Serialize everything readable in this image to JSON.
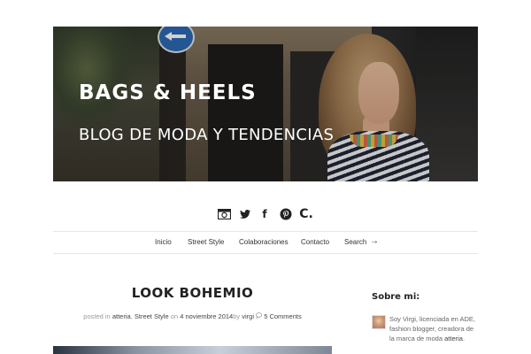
{
  "header": {
    "title": "BAGS & HEELS",
    "subtitle": "BLOG DE MODA Y TENDENCIAS"
  },
  "social": [
    {
      "icon": "camera-icon"
    },
    {
      "icon": "twitter-icon"
    },
    {
      "icon": "facebook-icon",
      "glyph": "f"
    },
    {
      "icon": "pinterest-icon"
    },
    {
      "icon": "chicisimo-icon",
      "glyph": "C."
    }
  ],
  "nav": {
    "items": [
      "Inicio",
      "Street Style",
      "Colaboraciones",
      "Contacto"
    ],
    "search_label": "Search",
    "search_arrow": "→"
  },
  "post": {
    "title": "LOOK BOHEMIO",
    "meta": {
      "posted_in": "posted in",
      "category1": "atteria",
      "sep": ",",
      "category2": "Street Style",
      "on": "on",
      "date": "4 noviembre 2014",
      "by": "by",
      "author": "virgi",
      "comments": "5 Comments"
    }
  },
  "sidebar": {
    "title": "Sobre mi:",
    "about_text": "Soy Virgi, licenciada en ADE, fashion blogger, creadora de la marca de moda",
    "about_link": "atteria",
    "about_end": "."
  },
  "colors": {
    "text": "#333333",
    "muted": "#9a9a9a",
    "divider": "#e6e6e6"
  }
}
